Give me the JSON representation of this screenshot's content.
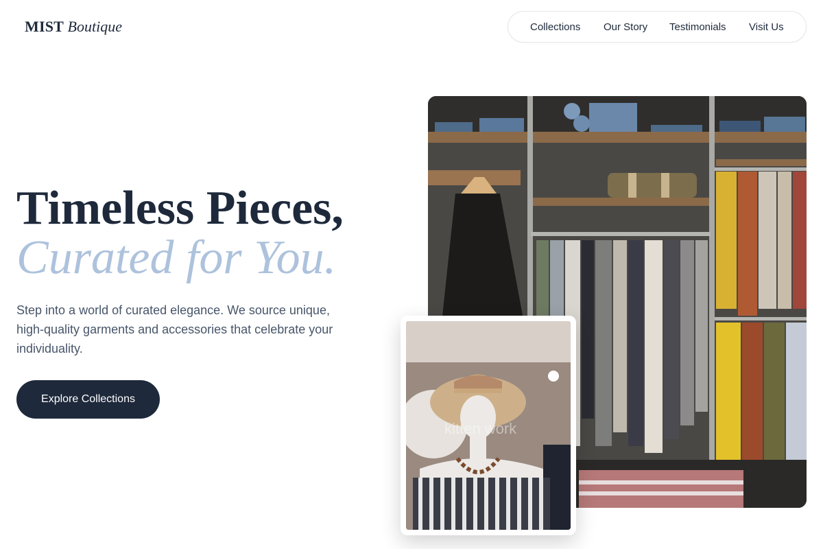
{
  "brand": {
    "name": "MIST",
    "subtitle": "Boutique"
  },
  "nav": {
    "items": [
      {
        "label": "Collections"
      },
      {
        "label": "Our Story"
      },
      {
        "label": "Testimonials"
      },
      {
        "label": "Visit Us"
      }
    ]
  },
  "hero": {
    "headline_line1": "Timeless Pieces,",
    "headline_line2": "Curated for You.",
    "description": "Step into a world of curated elegance. We source unique, high-quality garments and accessories that celebrate your individuality.",
    "cta_label": "Explore Collections"
  },
  "images": {
    "main_alt": "Boutique clothing racks with shelves of folded denim and hanging garments",
    "card_alt": "Mannequin wearing a straw hat and striped off-shoulder top",
    "watermark": "kitten work"
  },
  "colors": {
    "primary": "#1e293b",
    "accent": "#adc2dc",
    "body_text": "#475569"
  }
}
